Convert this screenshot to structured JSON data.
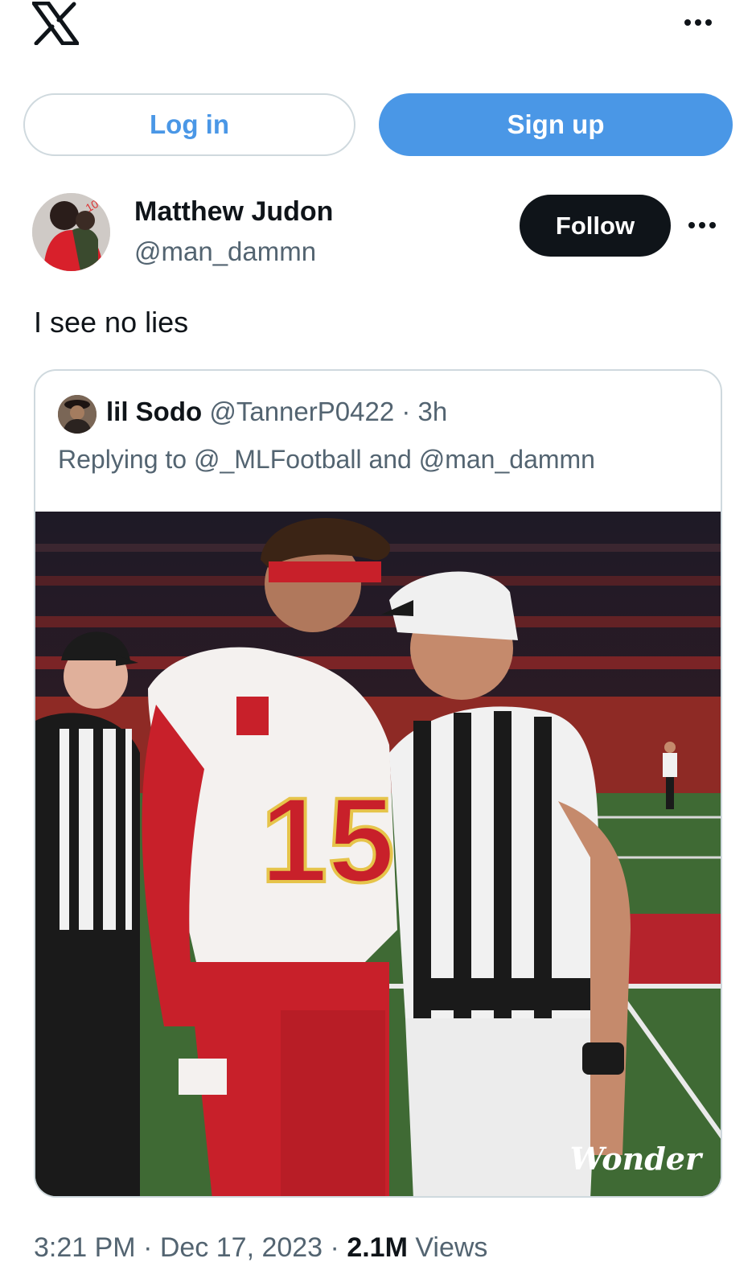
{
  "app": {
    "logo": "x-logo-icon"
  },
  "header": {
    "more_icon": "more-horizontal-icon"
  },
  "auth": {
    "login_label": "Log in",
    "signup_label": "Sign up"
  },
  "post": {
    "author_name": "Matthew Judon",
    "author_handle": "@man_dammn",
    "follow_label": "Follow",
    "text": "I see no lies",
    "timestamp": "3:21 PM · Dec 17, 2023 · ",
    "views_count": "2.1M",
    "views_label": " Views"
  },
  "quote": {
    "author_name": "lil Sodo",
    "author_handle": "@TannerP0422",
    "time": " · 3h",
    "replying_to": "Replying to @_MLFootball and @man_dammn",
    "watermark": "Wonder"
  },
  "colors": {
    "primary_blue": "#4a97e6",
    "text_dark": "#0f1419",
    "text_gray": "#536471",
    "border": "#cfd9de"
  }
}
